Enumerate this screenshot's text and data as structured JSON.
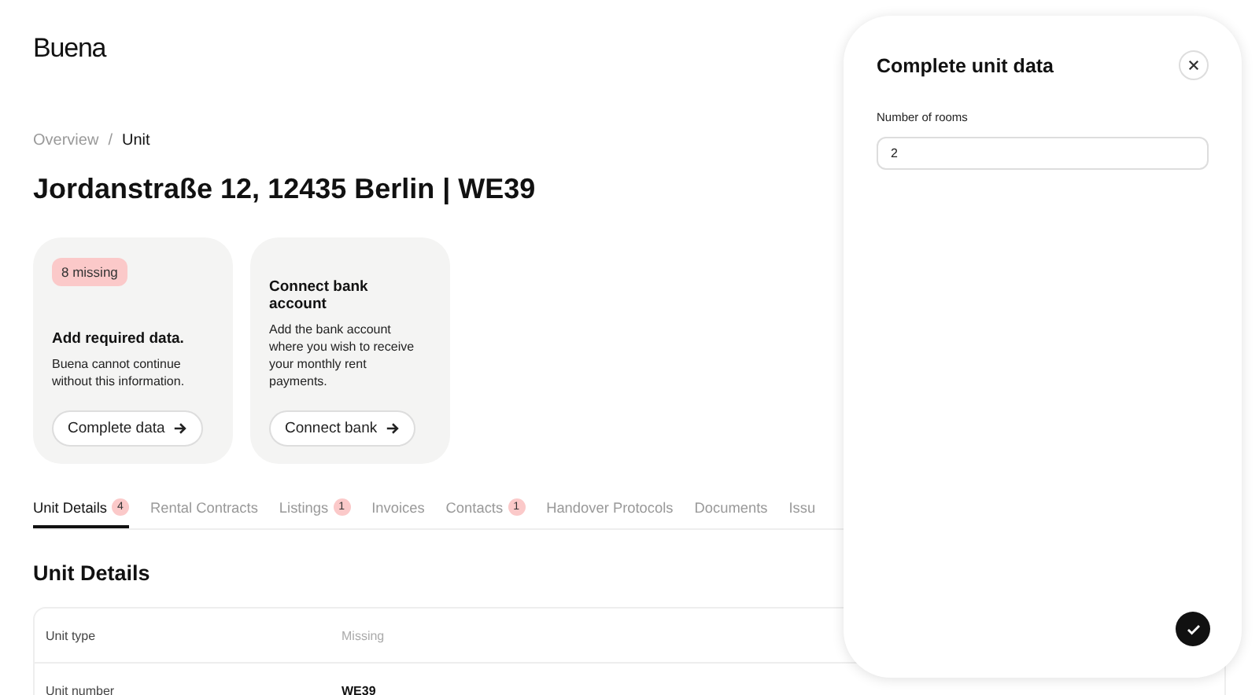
{
  "logo": "Buena",
  "breadcrumb_separator": "/",
  "breadcrumb": [
    {
      "label": "Overview",
      "selected": false
    },
    {
      "label": "Unit",
      "selected": true
    }
  ],
  "title": "Jordanstraße 12, 12435 Berlin | WE39",
  "cards": [
    {
      "badge": "8 missing",
      "heading": "Add required data.",
      "text": "Buena cannot continue without this information.",
      "button": "Complete data"
    },
    {
      "heading": "Connect bank account",
      "text": "Add the bank account where you wish to receive your monthly rent payments.",
      "button": "Connect bank"
    }
  ],
  "tabs": [
    {
      "label": "Unit Details",
      "count": "4",
      "selected": true
    },
    {
      "label": "Rental Contracts",
      "selected": false
    },
    {
      "label": "Listings",
      "count": "1",
      "selected": false
    },
    {
      "label": "Invoices",
      "selected": false
    },
    {
      "label": "Contacts",
      "count": "1",
      "selected": false
    },
    {
      "label": "Handover Protocols",
      "selected": false
    },
    {
      "label": "Documents",
      "selected": false
    },
    {
      "label": "Issu",
      "selected": false
    }
  ],
  "section_title": "Unit Details",
  "rows": [
    {
      "label": "Unit type",
      "value": "Missing",
      "missing": true
    },
    {
      "label": "Unit number",
      "value": "WE39",
      "missing": false
    }
  ],
  "panel": {
    "title": "Complete unit data",
    "field_label": "Number of rooms",
    "field_value": "2"
  }
}
